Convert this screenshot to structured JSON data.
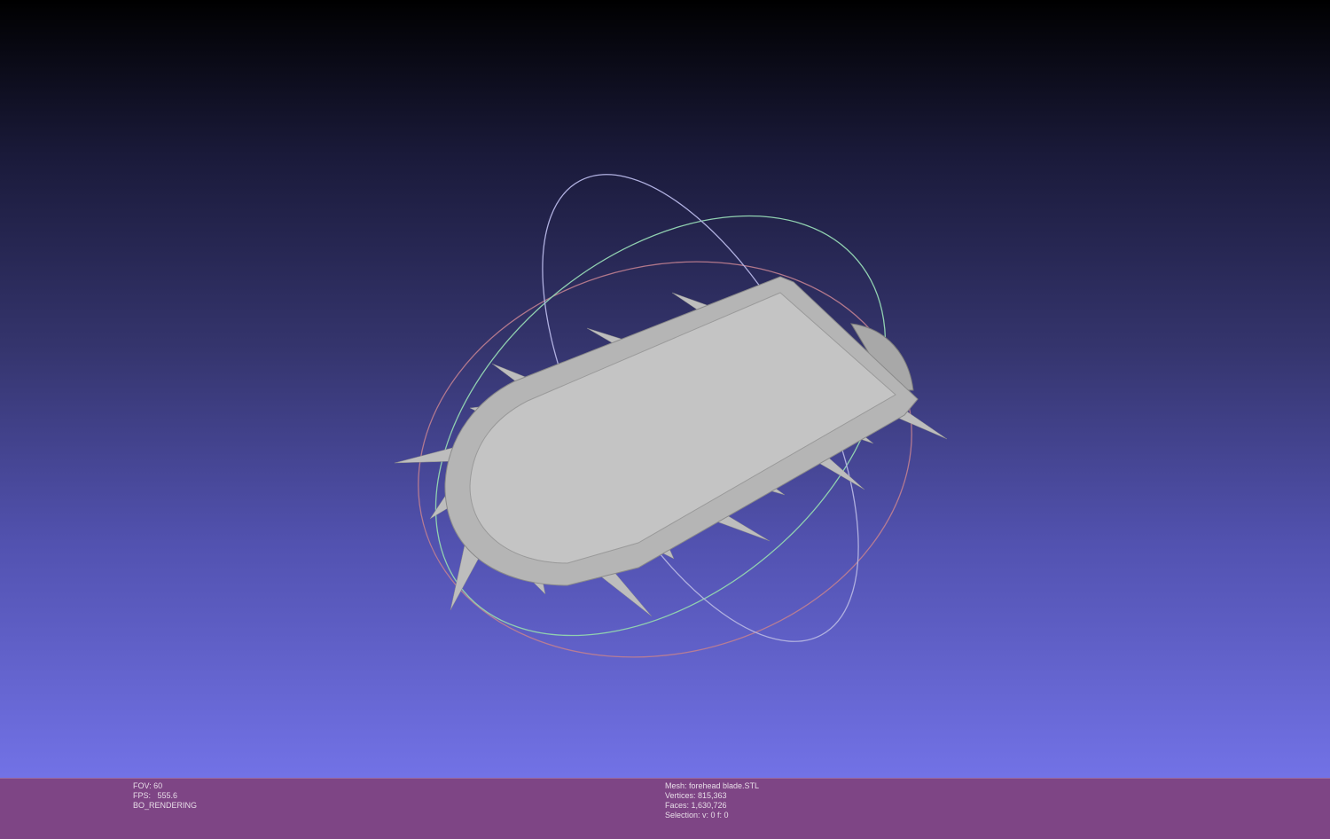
{
  "left_info": {
    "fov": "FOV: 60",
    "fps": "FPS:   555.6",
    "mode": "BO_RENDERING"
  },
  "right_info": {
    "mesh": "Mesh: forehead blade.STL",
    "vertices": "Vertices: 815,363",
    "faces": "Faces: 1,630,726",
    "selection": "Selection: v: 0 f: 0"
  },
  "colors": {
    "status_bar": "#7e4585",
    "background_bottom": "#7272e6",
    "mesh": "#c4c4c4"
  }
}
